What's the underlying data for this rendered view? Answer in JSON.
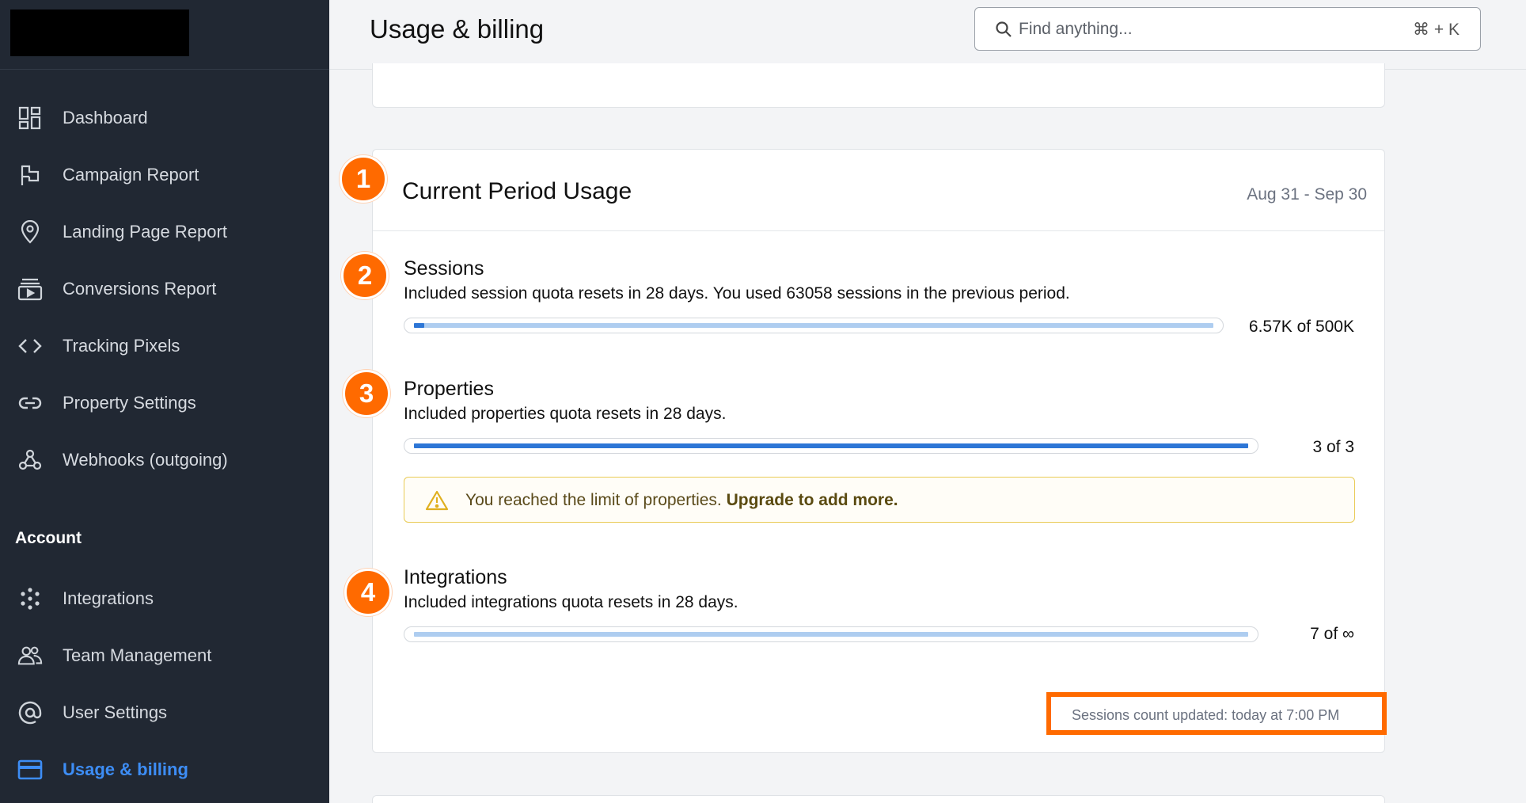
{
  "sidebar": {
    "nav_items": [
      {
        "label": "Dashboard",
        "icon": "dashboard-icon"
      },
      {
        "label": "Campaign Report",
        "icon": "flag-icon"
      },
      {
        "label": "Landing Page Report",
        "icon": "map-pin-icon"
      },
      {
        "label": "Conversions Report",
        "icon": "video-stack-icon"
      },
      {
        "label": "Tracking Pixels",
        "icon": "code-icon"
      },
      {
        "label": "Property Settings",
        "icon": "link-icon"
      },
      {
        "label": "Webhooks (outgoing)",
        "icon": "webhook-icon"
      }
    ],
    "account_title": "Account",
    "account_items": [
      {
        "label": "Integrations",
        "icon": "dots-grid-icon"
      },
      {
        "label": "Team Management",
        "icon": "users-icon"
      },
      {
        "label": "User Settings",
        "icon": "at-sign-icon"
      },
      {
        "label": "Usage & billing",
        "icon": "credit-card-icon",
        "active": true
      }
    ]
  },
  "header": {
    "title": "Usage & billing",
    "search_placeholder": "Find anything...",
    "search_shortcut": "⌘ + K"
  },
  "usage": {
    "title": "Current Period Usage",
    "period": "Aug 31 - Sep 30",
    "sessions": {
      "title": "Sessions",
      "description": "Included session quota resets in 28 days. You used 63058 sessions in the previous period.",
      "value_label": "6.57K of 500K",
      "fill_fraction": 0.0131
    },
    "properties": {
      "title": "Properties",
      "description": "Included properties quota resets in 28 days.",
      "value_label": "3 of 3",
      "fill_fraction": 1.0
    },
    "warning": {
      "text": "You reached the limit of properties.",
      "link": "Upgrade to add more."
    },
    "integrations": {
      "title": "Integrations",
      "description": "Included integrations quota resets in 28 days.",
      "value_label": "7 of ∞",
      "fill_fraction": 0
    },
    "updated_note": "Sessions count updated: today at 7:00 PM"
  },
  "badges": [
    "1",
    "2",
    "3",
    "4"
  ],
  "colors": {
    "sidebar_bg": "#212833",
    "accent": "#3d8df5",
    "badge": "#ff6a00",
    "bar_fill": "#2d76d6",
    "bar_track": "#aecdf0",
    "warning_border": "#e9cb55"
  }
}
